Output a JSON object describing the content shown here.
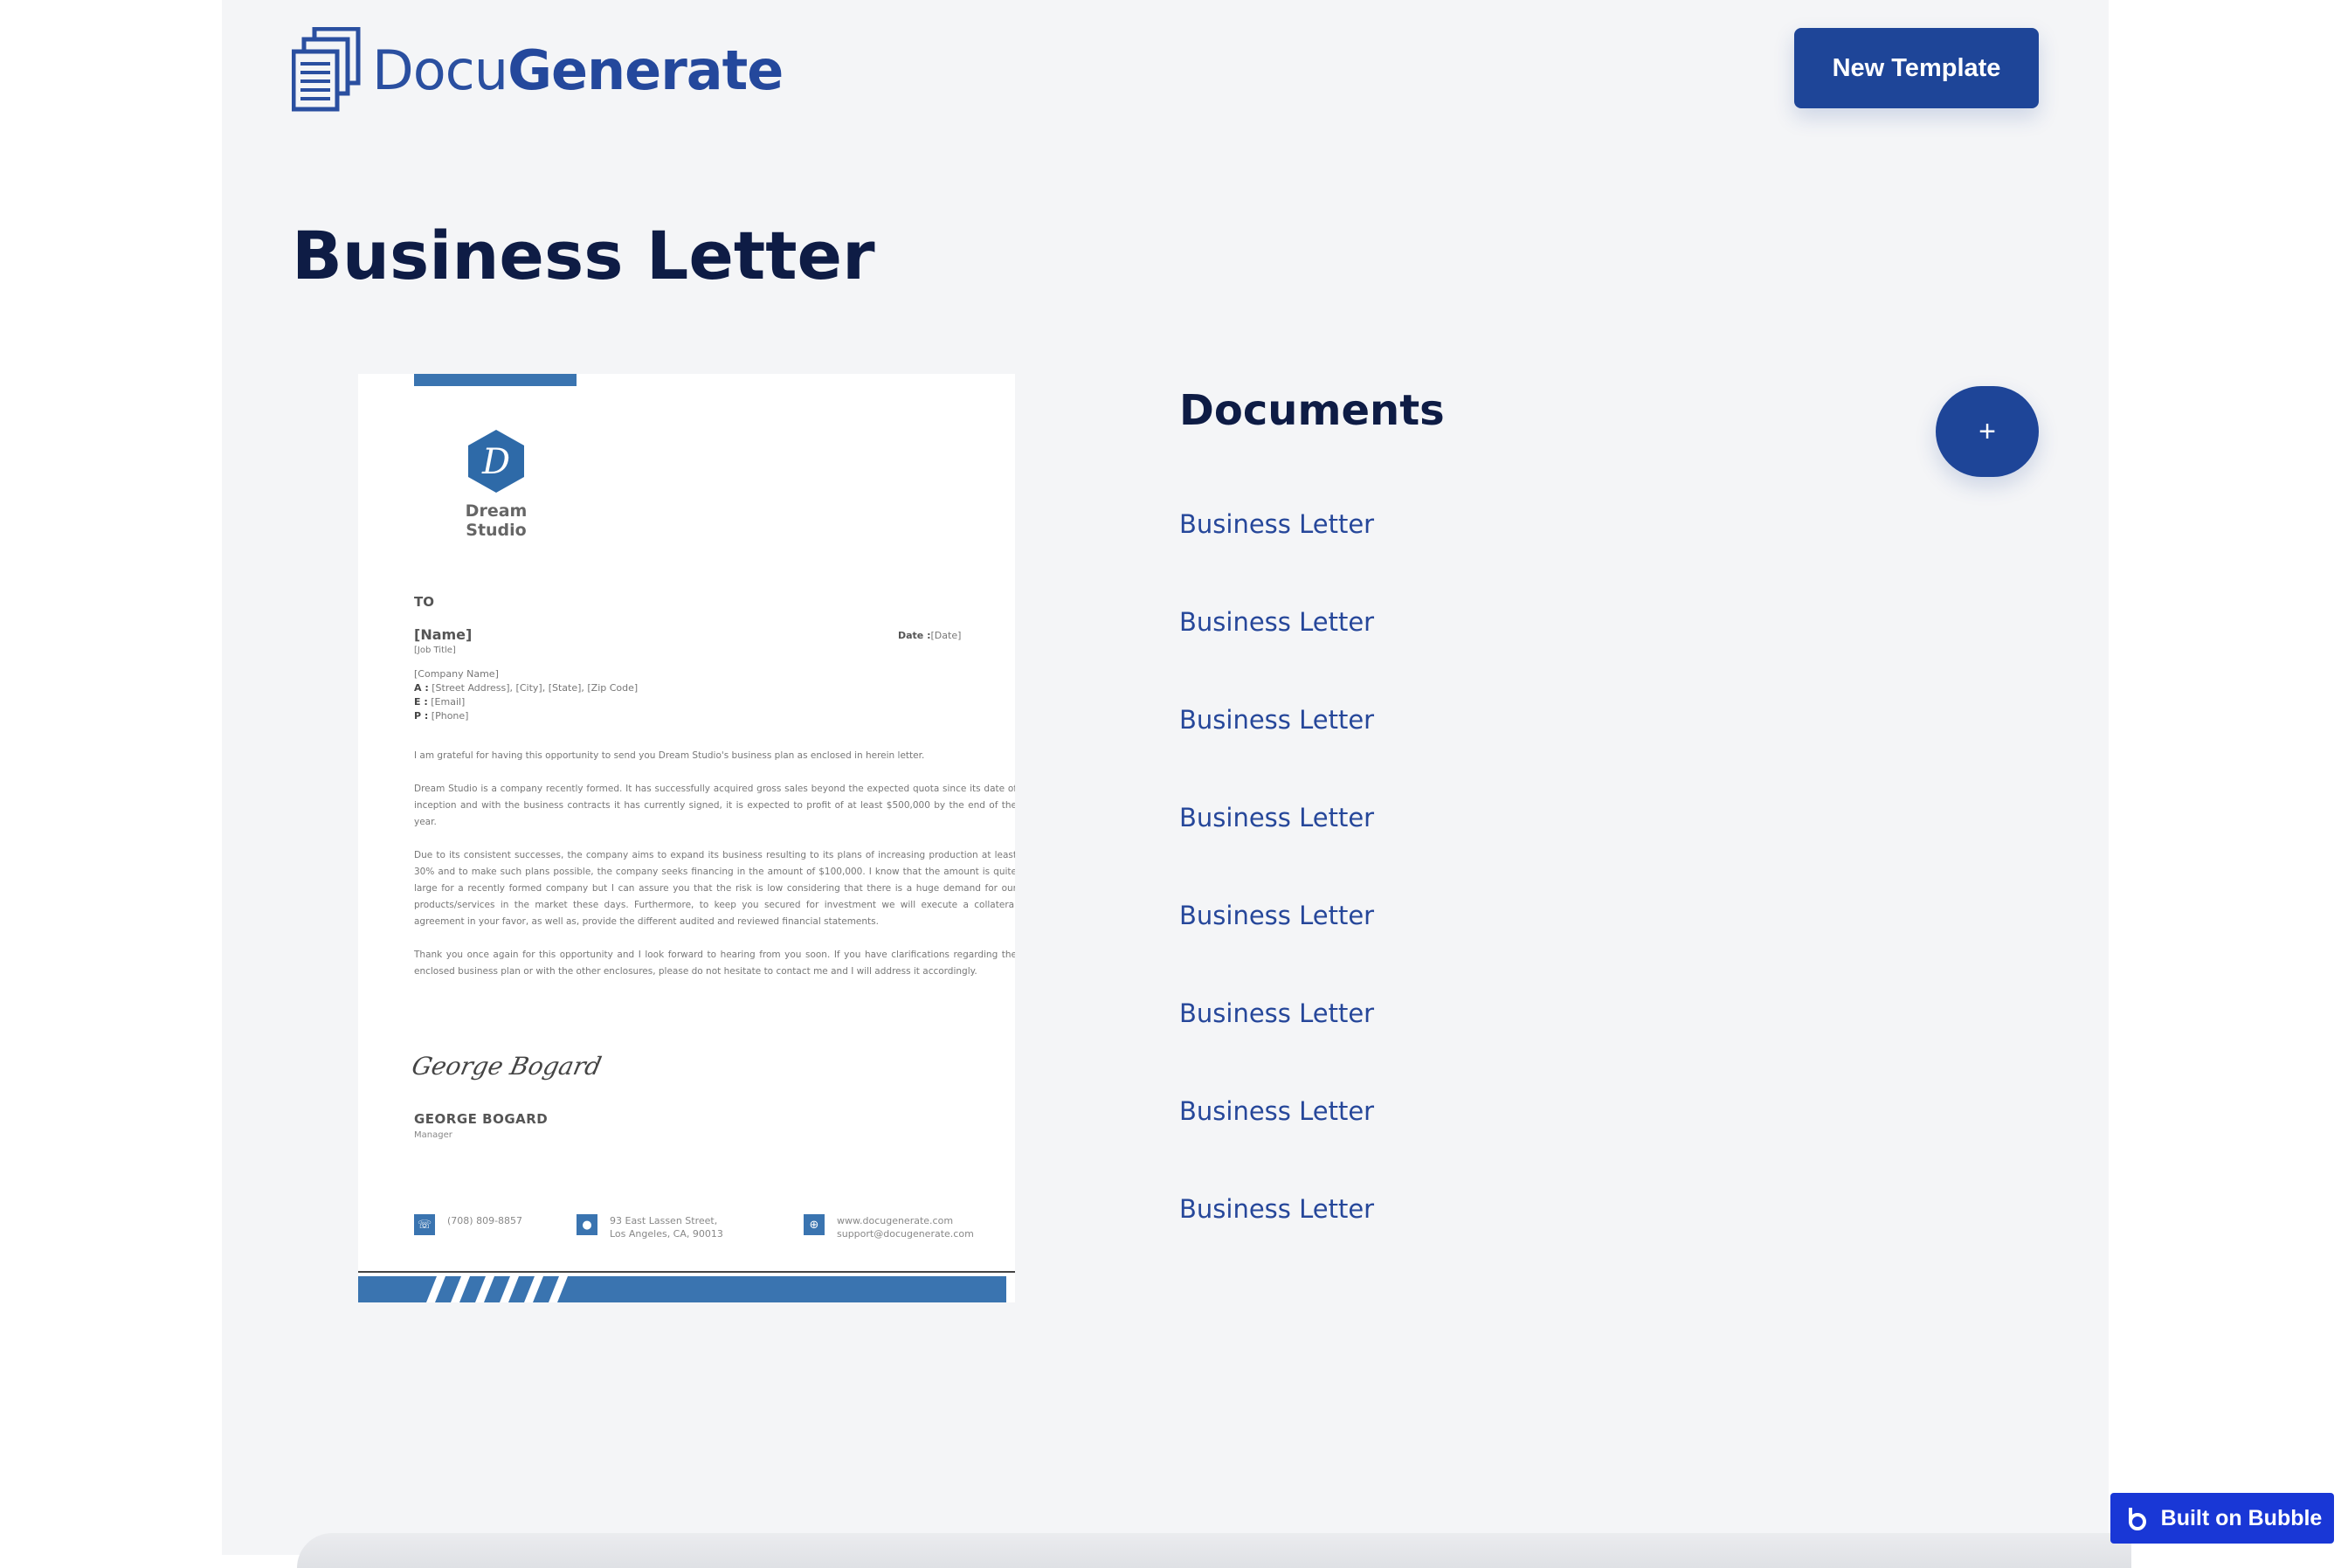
{
  "header": {
    "logo_part1": "Docu",
    "logo_part2": "Generate",
    "new_template_label": "New Template"
  },
  "page_title": "Business Letter",
  "preview": {
    "brand_name": "Dream Studio",
    "brand_initial": "D",
    "to_label": "TO",
    "name": "[Name]",
    "job_title": "[Job Title]",
    "date_label": "Date :",
    "date_value": "[Date]",
    "company": "[Company Name]",
    "address_label": "A :",
    "address_value": "[Street Address], [City], [State], [Zip Code]",
    "email_label": "E :",
    "email_value": "[Email]",
    "phone_label": "P :",
    "phone_value": "[Phone]",
    "paragraphs": [
      "I am grateful for having this opportunity to send you Dream Studio's business plan as enclosed in herein letter.",
      "Dream Studio is a company recently formed. It has successfully acquired gross sales beyond the expected quota since its date of inception and with the business contracts it has currently signed, it is expected to profit of at least $500,000 by the end of the year.",
      "Due to its consistent successes, the company aims to expand its business resulting to its plans of increasing production at least 30% and to make such plans possible, the company seeks financing in the amount of $100,000. I know that the amount is quite large for a recently formed company but I can assure you that the risk is low considering that there is a huge demand for our products/services in the market these days. Furthermore, to keep you secured for investment we will execute a collateral agreement in your favor, as well as, provide the different audited and reviewed financial statements.",
      "Thank you once again for this opportunity and I look forward to hearing from you soon. If you have clarifications regarding the enclosed business plan or with the other enclosures, please do not hesitate to contact me and I will address it accordingly."
    ],
    "signature": "George Bogard",
    "signer_name": "GEORGE BOGARD",
    "signer_title": "Manager",
    "footer_phone": "(708) 809-8857",
    "footer_address_1": "93 East Lassen Street,",
    "footer_address_2": "Los Angeles, CA, 90013",
    "footer_web": "www.docugenerate.com",
    "footer_email": "support@docugenerate.com"
  },
  "documents": {
    "title": "Documents",
    "add_label": "+",
    "items": [
      "Business Letter",
      "Business Letter",
      "Business Letter",
      "Business Letter",
      "Business Letter",
      "Business Letter",
      "Business Letter",
      "Business Letter"
    ]
  },
  "badge": {
    "label": "Built on Bubble"
  },
  "colors": {
    "brand": "#1e4598",
    "title": "#0e1c45",
    "letter_accent": "#3a74b0",
    "bubble": "#1937d6"
  }
}
